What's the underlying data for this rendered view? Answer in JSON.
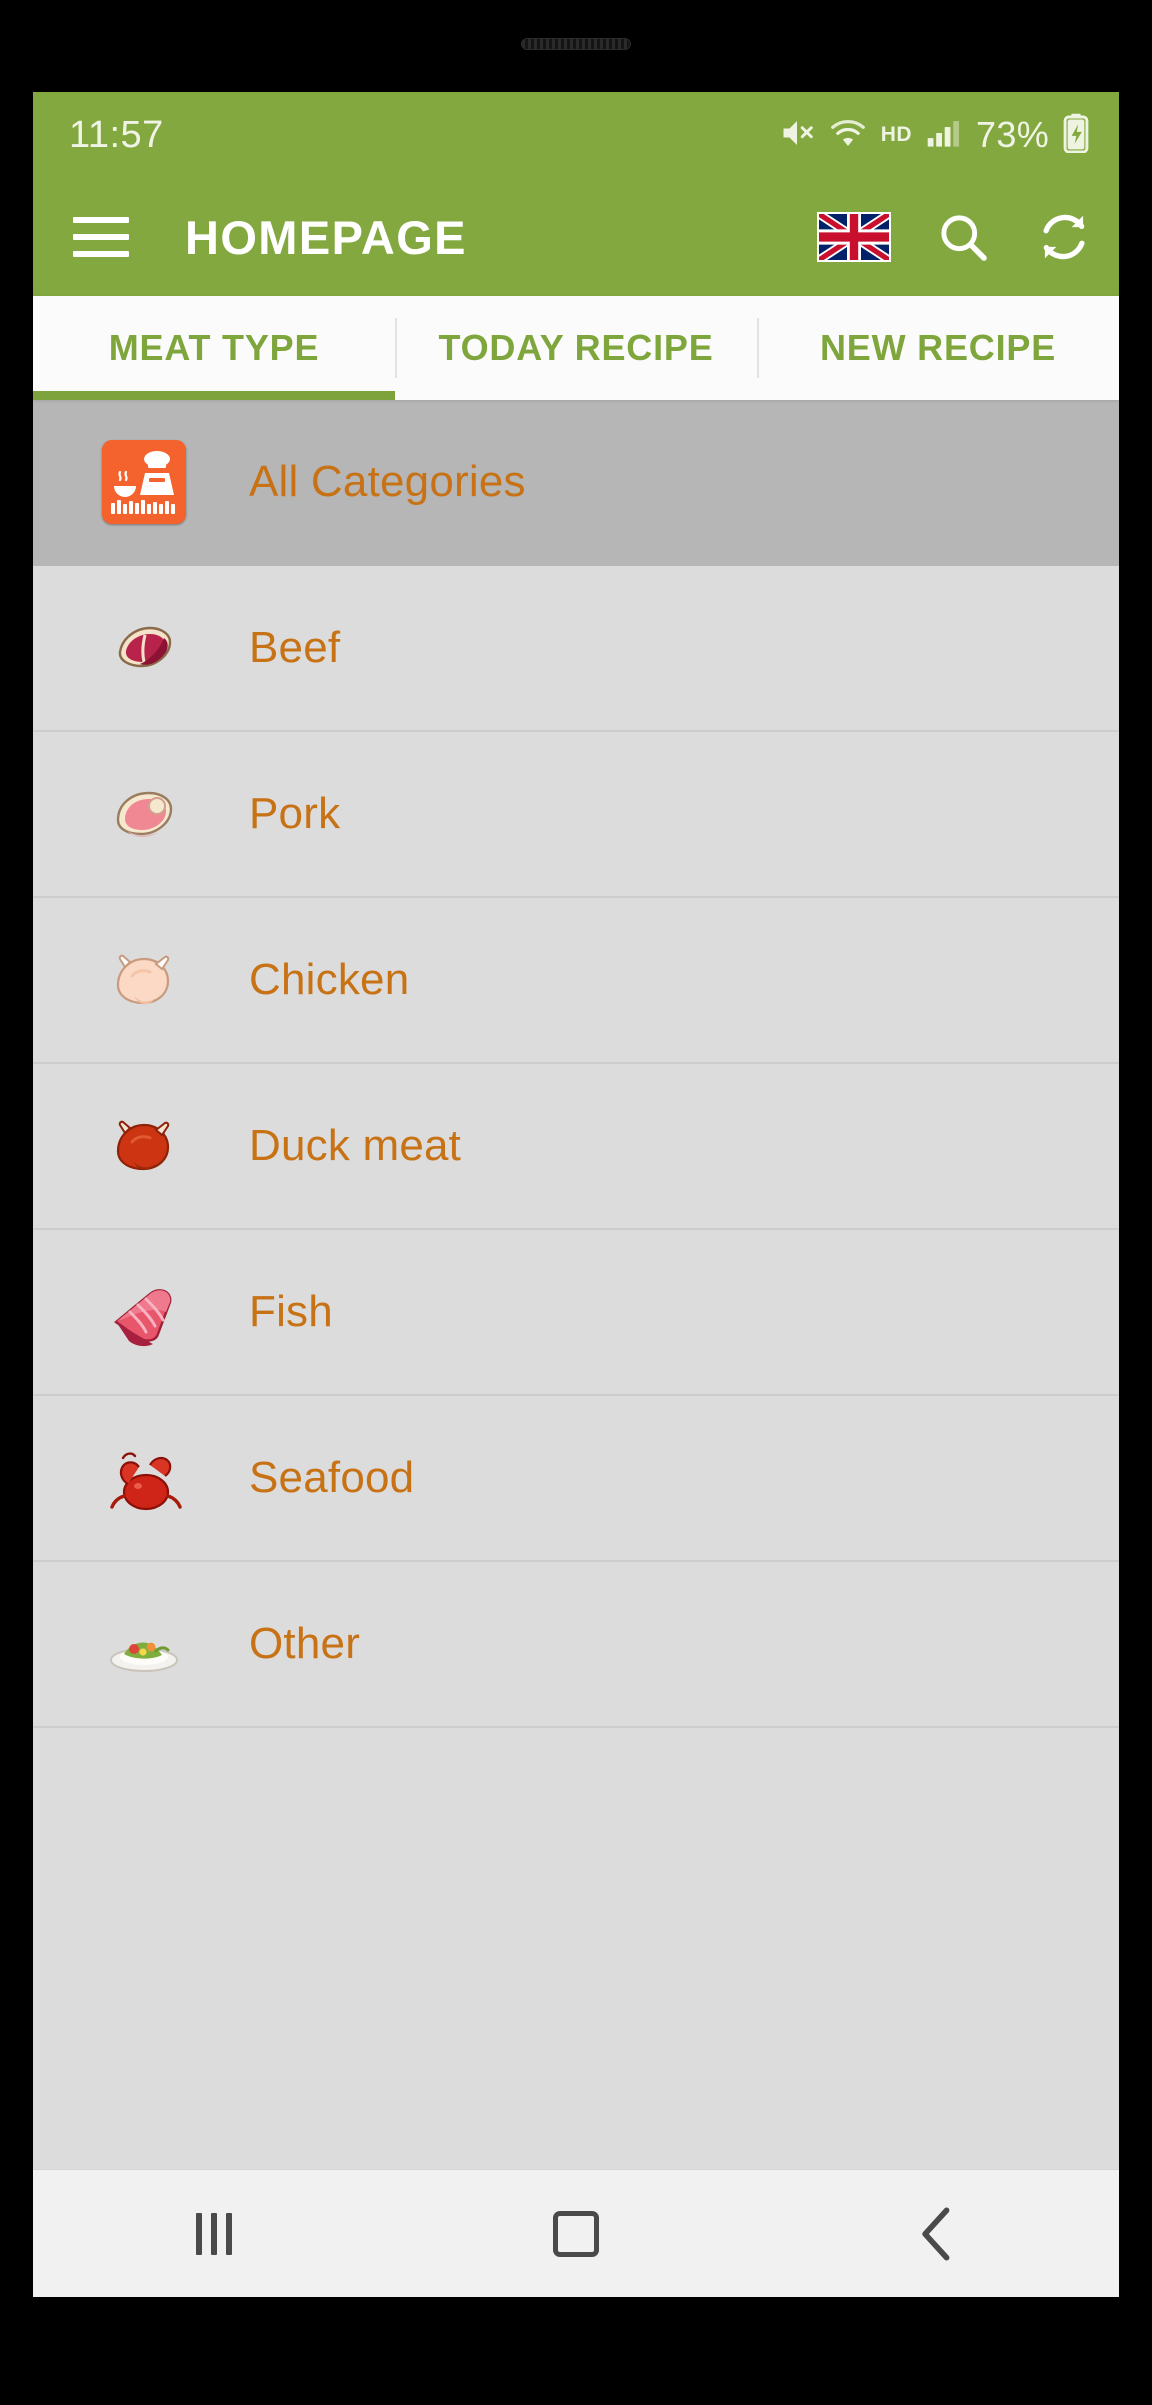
{
  "status_bar": {
    "time": "11:57",
    "battery_percent": "73%",
    "hd_label": "HD",
    "icons": [
      "mute-icon",
      "wifi-icon",
      "hd-icon",
      "cellular-signal-icon",
      "battery-charging-icon"
    ]
  },
  "app_bar": {
    "title": "HOMEPAGE",
    "menu_icon": "hamburger-menu-icon",
    "flag_icon": "uk-flag-icon",
    "search_icon": "search-icon",
    "refresh_icon": "refresh-icon"
  },
  "tabs": [
    {
      "label": "MEAT TYPE",
      "active": true
    },
    {
      "label": "TODAY RECIPE",
      "active": false
    },
    {
      "label": "NEW RECIPE",
      "active": false
    }
  ],
  "categories": [
    {
      "label": "All Categories",
      "icon": "app-logo-icon",
      "selected": true
    },
    {
      "label": "Beef",
      "icon": "beef-steak-icon",
      "selected": false
    },
    {
      "label": "Pork",
      "icon": "pork-chop-icon",
      "selected": false
    },
    {
      "label": "Chicken",
      "icon": "whole-chicken-icon",
      "selected": false
    },
    {
      "label": "Duck meat",
      "icon": "roast-duck-icon",
      "selected": false
    },
    {
      "label": "Fish",
      "icon": "fish-fillet-icon",
      "selected": false
    },
    {
      "label": "Seafood",
      "icon": "crab-icon",
      "selected": false
    },
    {
      "label": "Other",
      "icon": "salad-plate-icon",
      "selected": false
    }
  ],
  "nav_bar": {
    "recents_label": "recents-icon",
    "home_label": "home-icon",
    "back_label": "back-icon"
  },
  "colors": {
    "brand_green": "#83a83f",
    "tab_text": "#7fa63c",
    "list_text": "#c87216",
    "list_bg": "#dcdcdc",
    "selected_bg": "#b6b6b6",
    "app_icon_orange": "#f4622d"
  }
}
